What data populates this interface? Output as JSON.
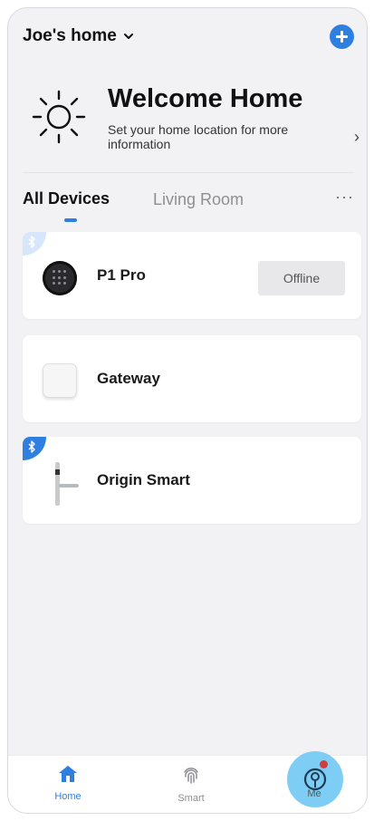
{
  "header": {
    "home_name": "Joe's home",
    "add_icon": "add-circle-icon",
    "accent_color": "#2f7fe0"
  },
  "welcome": {
    "title": "Welcome Home",
    "subtitle": "Set your home location for more information",
    "arrow": "›",
    "icon": "sun-icon"
  },
  "tabs": {
    "all_devices": "All Devices",
    "living_room": "Living Room",
    "more": "···"
  },
  "devices": [
    {
      "name": "P1 Pro",
      "status": "Offline",
      "icon": "keypad-lock-icon",
      "bluetooth": true
    },
    {
      "name": "Gateway",
      "icon": "gateway-icon",
      "bluetooth": false
    },
    {
      "name": "Origin Smart",
      "icon": "door-handle-icon",
      "bluetooth": true
    }
  ],
  "nav": {
    "home": "Home",
    "smart": "Smart",
    "me": "Me"
  }
}
